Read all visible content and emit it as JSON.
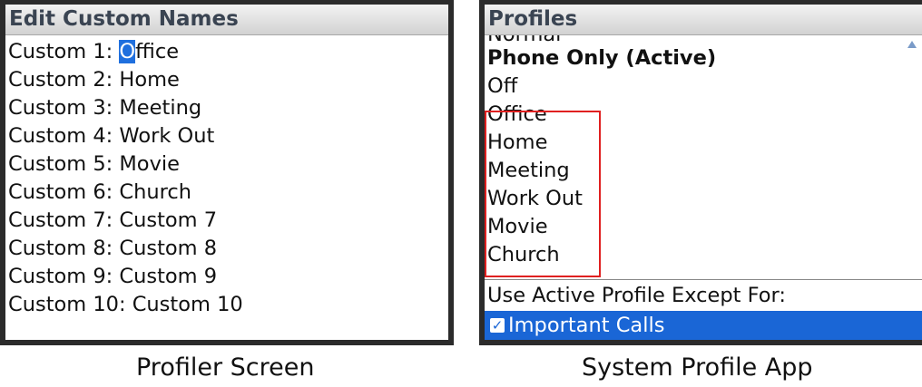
{
  "left": {
    "title": "Edit Custom Names",
    "first_prefix": "Custom 1: ",
    "first_cursor_char": "O",
    "first_rest": "ffice",
    "items": [
      "Custom 2: Home",
      "Custom 3: Meeting",
      "Custom 4: Work Out",
      "Custom 5: Movie",
      "Custom 6: Church",
      "Custom 7: Custom 7",
      "Custom 8: Custom 8",
      "Custom 9: Custom 9",
      "Custom 10: Custom 10"
    ],
    "caption": "Profiler Screen"
  },
  "right": {
    "title": "Profiles",
    "partial_item": "Normal",
    "active_item": "Phone Only (Active)",
    "off_item": "Off",
    "custom_items": [
      "Office",
      "Home",
      "Meeting",
      "Work Out",
      "Movie",
      "Church"
    ],
    "exception_label": "Use Active Profile Except For:",
    "selected_option": "Important Calls",
    "checkbox_checked": true,
    "caption": "System Profile App"
  },
  "colors": {
    "highlight": "#1a66d6",
    "red_box": "#e02020",
    "frame": "#2b2b2b"
  }
}
